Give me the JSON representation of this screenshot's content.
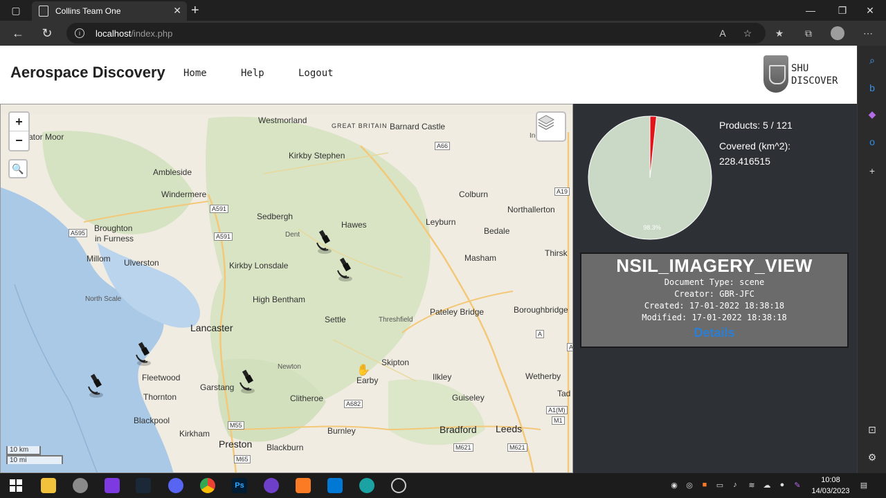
{
  "browser": {
    "tab_title": "Collins Team One",
    "url_host": "localhost",
    "url_path": "/index.php"
  },
  "site": {
    "brand": "Aerospace Discovery",
    "nav": [
      "Home",
      "Help",
      "Logout"
    ],
    "logo_line1": "SHU",
    "logo_line2": "DISCOVER"
  },
  "map": {
    "zoom_in": "+",
    "zoom_out": "−",
    "scale_km": "10 km",
    "scale_mi": "10 mi",
    "places": [
      "Westmorland",
      "GREAT BRITAIN",
      "Barnard Castle",
      "ator Moor",
      "Kirkby Stephen",
      "Ambleside",
      "Windermere",
      "Colburn",
      "Northallerton",
      "Sedbergh",
      "Hawes",
      "Leyburn",
      "Bedale",
      "Broughton",
      "in Furness",
      "Dent",
      "Millom",
      "Ulverston",
      "Kirkby Lonsdale",
      "Masham",
      "Thirsk",
      "North Scale",
      "High Bentham",
      "Pateley Bridge",
      "Boroughbridge",
      "Lancaster",
      "Settle",
      "Threshfield",
      "Skipton",
      "Fleetwood",
      "Newton",
      "Earby",
      "Ilkley",
      "Wetherby",
      "Garstang",
      "Thornton",
      "Clitheroe",
      "Guiseley",
      "Tad",
      "Blackpool",
      "Kirkham",
      "Preston",
      "Blackburn",
      "Burnley",
      "Bradford",
      "Leeds",
      "Ingleby B"
    ],
    "roads": [
      "A66",
      "A19",
      "A591",
      "A595",
      "A591",
      "A682",
      "M55",
      "M65",
      "M621",
      "M621",
      "A1(M)",
      "M1",
      "A",
      "A"
    ]
  },
  "stats": {
    "products": "Products: 5 / 121",
    "covered_label": "Covered (km^2):",
    "covered_value": "228.416515",
    "pie_label": "98.3%",
    "pie_percent": 98.3
  },
  "card": {
    "title": "NSIL_IMAGERY_VIEW",
    "doc_type": "Document Type: scene",
    "creator": "Creator: GBR-JFC",
    "created": "Created: 17-01-2022 18:38:18",
    "modified": "Modified: 17-01-2022 18:38:18",
    "details": "Details"
  },
  "taskbar": {
    "time": "10:08",
    "date": "14/03/2023"
  },
  "colors": {
    "pie_main": "#c9d9c6",
    "pie_slice": "#e0141a",
    "details_link": "#2a7fd4"
  }
}
